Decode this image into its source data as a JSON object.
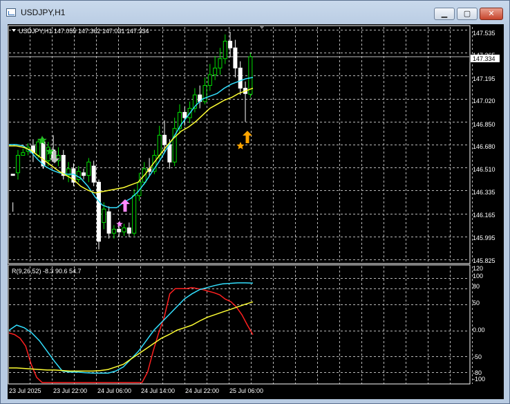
{
  "window": {
    "title": "USDJPY,H1",
    "minimize_glyph": "▁",
    "maximize_glyph": "▢",
    "close_glyph": "✕"
  },
  "main_chart": {
    "header": "USDJPY,H1  147.055 147.362 147.031 147.334",
    "price_labels": [
      "147.535",
      "147.365",
      "147.195",
      "147.020",
      "146.850",
      "146.680",
      "146.510",
      "146.335",
      "146.165",
      "145.995",
      "145.825"
    ],
    "current_price": "147.334",
    "colors": {
      "bull": "#00e000",
      "bear": "#ffffff",
      "fast_ma": "#33e0ff",
      "slow_ma": "#ffff33"
    }
  },
  "indicator": {
    "header": "R(9,26,52) -8.3 90.6 54.7",
    "level_labels": [
      "120",
      "100",
      "80",
      "50",
      "0.00",
      "-50",
      "-80",
      "-100"
    ]
  },
  "time_axis": {
    "labels": [
      "23 Jul 2025",
      "23 Jul 22:00",
      "24 Jul 06:00",
      "24 Jul 14:00",
      "24 Jul 22:00",
      "25 Jul 06:00"
    ]
  },
  "chart_data": [
    {
      "type": "candlestick",
      "title": "USDJPY,H1",
      "ylim": [
        145.825,
        147.535
      ],
      "x": [
        "23 Jul 2025",
        "23 Jul 22:00",
        "24 Jul 06:00",
        "24 Jul 14:00",
        "24 Jul 22:00",
        "25 Jul 06:00"
      ],
      "last": {
        "open": 147.055,
        "high": 147.362,
        "low": 147.031,
        "close": 147.334
      },
      "candles": [
        [
          146.46,
          146.45,
          146.25,
          146.18
        ],
        [
          146.47,
          146.6,
          146.64,
          146.42
        ],
        [
          146.6,
          146.62,
          146.65,
          146.6
        ],
        [
          146.63,
          146.66,
          146.69,
          146.6
        ],
        [
          146.67,
          146.62,
          146.72,
          146.55
        ],
        [
          146.6,
          146.7,
          146.72,
          146.58
        ],
        [
          146.7,
          146.52,
          146.73,
          146.5
        ],
        [
          146.56,
          146.66,
          146.7,
          146.52
        ],
        [
          146.64,
          146.58,
          146.75,
          146.55
        ],
        [
          146.56,
          146.6,
          146.66,
          146.52
        ],
        [
          146.6,
          146.45,
          146.64,
          146.42
        ],
        [
          146.45,
          146.5,
          146.55,
          146.4
        ],
        [
          146.5,
          146.4,
          146.54,
          146.37
        ],
        [
          146.42,
          146.48,
          146.52,
          146.4
        ],
        [
          146.47,
          146.45,
          146.5,
          146.42
        ],
        [
          146.45,
          146.55,
          146.58,
          146.4
        ],
        [
          146.52,
          146.4,
          146.56,
          146.37
        ],
        [
          146.4,
          145.96,
          146.42,
          145.9
        ],
        [
          146.1,
          146.2,
          146.25,
          146.05
        ],
        [
          146.18,
          146.02,
          146.22,
          145.98
        ],
        [
          146.02,
          146.05,
          146.08,
          145.98
        ],
        [
          146.05,
          146.03,
          146.1,
          145.99
        ],
        [
          146.03,
          146.06,
          146.09,
          146.0
        ],
        [
          146.06,
          146.02,
          146.1,
          145.99
        ],
        [
          146.02,
          146.3,
          146.35,
          146.0
        ],
        [
          146.3,
          146.4,
          146.47,
          146.26
        ],
        [
          146.4,
          146.5,
          146.55,
          146.38
        ],
        [
          146.5,
          146.48,
          146.58,
          146.44
        ],
        [
          146.48,
          146.6,
          146.64,
          146.46
        ],
        [
          146.6,
          146.75,
          146.82,
          146.57
        ],
        [
          146.75,
          146.68,
          146.86,
          146.62
        ],
        [
          146.68,
          146.55,
          146.72,
          146.5
        ],
        [
          146.55,
          146.8,
          146.88,
          146.52
        ],
        [
          146.8,
          146.92,
          146.98,
          146.76
        ],
        [
          146.92,
          146.88,
          146.96,
          146.82
        ],
        [
          146.88,
          146.95,
          147.0,
          146.84
        ],
        [
          146.95,
          147.05,
          147.1,
          146.92
        ],
        [
          147.05,
          147.0,
          147.12,
          146.95
        ],
        [
          147.0,
          147.12,
          147.18,
          146.98
        ],
        [
          147.12,
          147.2,
          147.28,
          147.08
        ],
        [
          147.2,
          147.25,
          147.34,
          147.16
        ],
        [
          147.25,
          147.32,
          147.4,
          147.2
        ],
        [
          147.32,
          147.45,
          147.5,
          147.28
        ],
        [
          147.45,
          147.4,
          147.52,
          147.33
        ],
        [
          147.4,
          147.25,
          147.46,
          147.18
        ],
        [
          147.25,
          147.1,
          147.3,
          147.05
        ],
        [
          147.1,
          147.06,
          147.15,
          146.85
        ],
        [
          147.055,
          147.334,
          147.362,
          147.031
        ]
      ],
      "series": [
        {
          "name": "fast MA",
          "values": [
            146.68,
            146.68,
            146.67,
            146.63,
            146.57,
            146.52,
            146.49,
            146.47,
            146.46,
            146.46,
            146.43,
            146.37,
            146.29,
            146.23,
            146.21,
            146.21,
            146.25,
            146.28,
            146.33,
            146.4,
            146.48,
            146.56,
            146.65,
            146.74,
            146.83,
            146.9,
            146.97,
            147.02,
            147.04,
            147.06,
            147.1,
            147.13,
            147.15,
            147.17,
            147.18
          ]
        },
        {
          "name": "slow MA",
          "values": [
            146.67,
            146.67,
            146.66,
            146.64,
            146.6,
            146.56,
            146.52,
            146.48,
            146.45,
            146.42,
            146.37,
            146.34,
            146.32,
            146.33,
            146.34,
            146.35,
            146.36,
            146.38,
            146.4,
            146.46,
            146.53,
            146.6,
            146.67,
            146.73,
            146.78,
            146.81,
            146.85,
            146.9,
            146.95,
            146.98,
            147.01,
            147.03,
            147.06,
            147.08,
            147.1
          ]
        }
      ]
    },
    {
      "type": "line",
      "title": "R(9,26,52)",
      "ylim": [
        -100,
        120
      ],
      "series": [
        {
          "name": "R(9)",
          "last": -8.3,
          "values": [
            -5,
            -8,
            -15,
            -30,
            -65,
            -90,
            -100,
            -110,
            -125,
            -140,
            -155,
            -168,
            -180,
            -185,
            -188,
            -190,
            -190,
            -188,
            -185,
            -180,
            -175,
            -168,
            -160,
            -150,
            -120,
            -80,
            -40,
            -5,
            25,
            70,
            80,
            80,
            80,
            82,
            80,
            78,
            75,
            72,
            68,
            60,
            55,
            45,
            30,
            10,
            -8.3
          ]
        },
        {
          "name": "R(26)",
          "last": 90.6,
          "values": [
            0,
            10,
            5,
            -5,
            -20,
            -40,
            -60,
            -78,
            -80,
            -80,
            -81,
            -82,
            -82,
            -82,
            -78,
            -70,
            -55,
            -40,
            -20,
            0,
            15,
            30,
            45,
            60,
            70,
            78,
            82,
            86,
            89,
            90,
            91,
            91,
            90.6
          ]
        },
        {
          "name": "R(52)",
          "last": 54.7,
          "values": [
            -72,
            -72,
            -73,
            -74,
            -75,
            -76,
            -76,
            -77,
            -78,
            -78,
            -78,
            -78,
            -77,
            -75,
            -70,
            -65,
            -55,
            -45,
            -35,
            -25,
            -15,
            -8,
            0,
            5,
            10,
            18,
            25,
            30,
            35,
            40,
            45,
            50,
            54.7
          ]
        }
      ]
    }
  ]
}
